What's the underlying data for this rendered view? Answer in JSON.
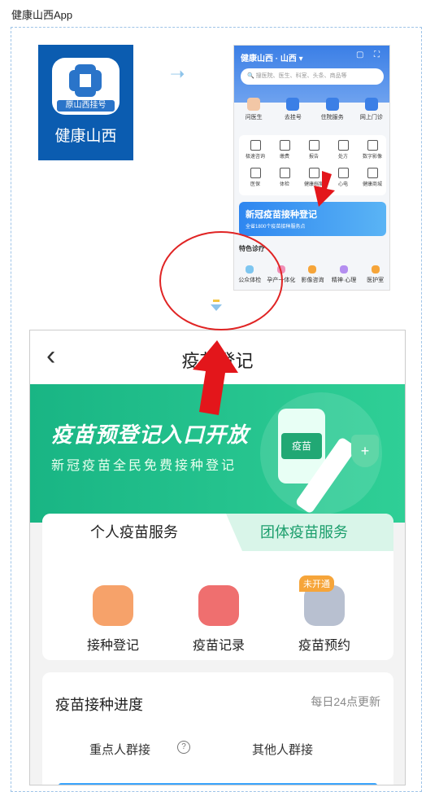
{
  "page_title": "健康山西App",
  "app_icon": {
    "tag": "原山西挂号",
    "name": "健康山西"
  },
  "phone": {
    "header_title": "健康山西 · 山西 ▾",
    "search_placeholder": "搜医院、医生、科室、头条、商品等",
    "top_items": [
      "问医生",
      "去挂号",
      "住院服务",
      "网上门诊"
    ],
    "grid_items": [
      "极速咨询",
      "缴费",
      "报告",
      "处方",
      "数字影像",
      "医保",
      "体检",
      "健康档案",
      "心电",
      "健康商城"
    ],
    "banner_title": "新冠疫苗接种登记",
    "banner_sub": "全省1800个疫苗接种服务点",
    "feature_title": "特色诊疗",
    "bottom_items": [
      "公众体检",
      "孕产一体化",
      "影像咨询",
      "精神·心理",
      "医护室"
    ]
  },
  "vaccine_page": {
    "nav_title": "疫苗登记",
    "back_icon": "back-chevron-icon",
    "hero_title": "疫苗预登记入口开放",
    "hero_subtitle": "新冠疫苗全民免费接种登记",
    "hero_bottle_label": "疫苗",
    "tabs": [
      "个人疫苗服务",
      "团体疫苗服务"
    ],
    "services": [
      {
        "label": "接种登记",
        "color": "#f6a26a"
      },
      {
        "label": "疫苗记录",
        "color": "#ef6f6f"
      },
      {
        "label": "疫苗预约",
        "color": "#b8c0d0",
        "badge": "未开通"
      }
    ],
    "progress_title": "疫苗接种进度",
    "progress_update": "每日24点更新",
    "groups": [
      "重点人群接",
      "其他人群接"
    ],
    "help_icon": "?"
  },
  "colors": {
    "accent": "#19b584",
    "highlight": "#e02424",
    "blue": "#3b7fe6"
  }
}
